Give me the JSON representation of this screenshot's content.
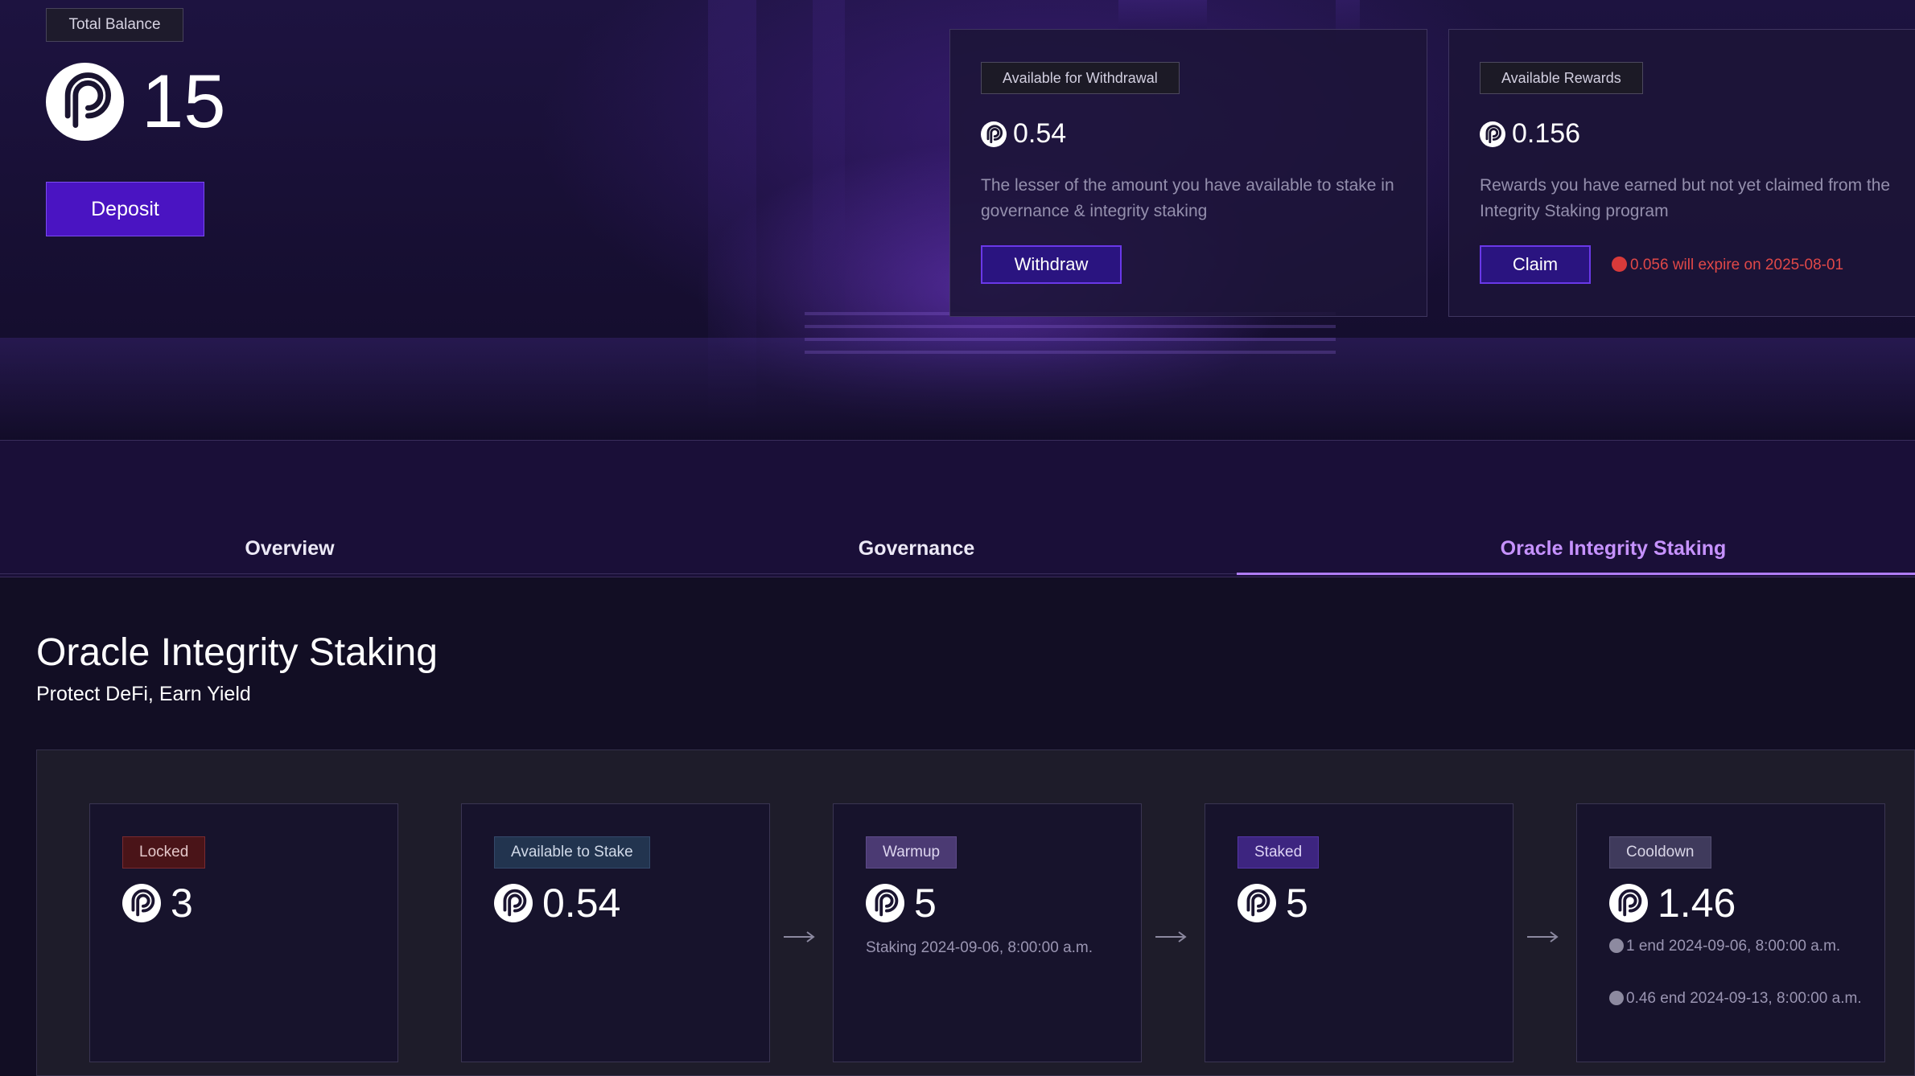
{
  "balance": {
    "label": "Total Balance",
    "value": "15",
    "deposit_label": "Deposit"
  },
  "withdrawal_card": {
    "label": "Available for Withdrawal",
    "value": "0.54",
    "description": "The lesser of the amount you have available to stake in governance & integrity staking",
    "button_label": "Withdraw"
  },
  "rewards_card": {
    "label": "Available Rewards",
    "value": "0.156",
    "description": "Rewards you have earned but not yet claimed from the Integrity Staking program",
    "button_label": "Claim",
    "expiry_warning": "0.056 will expire on 2025-08-01"
  },
  "tabs": [
    {
      "label": "Overview",
      "active": false
    },
    {
      "label": "Governance",
      "active": false
    },
    {
      "label": "Oracle Integrity Staking",
      "active": true
    }
  ],
  "section": {
    "title": "Oracle Integrity Staking",
    "subtitle": "Protect DeFi, Earn Yield"
  },
  "stages": [
    {
      "label": "Locked",
      "value": "3"
    },
    {
      "label": "Available to Stake",
      "value": "0.54"
    },
    {
      "label": "Warmup",
      "value": "5",
      "note": "Staking 2024-09-06, 8:00:00 a.m."
    },
    {
      "label": "Staked",
      "value": "5"
    },
    {
      "label": "Cooldown",
      "value": "1.46",
      "notes": [
        "1 end 2024-09-06, 8:00:00 a.m.",
        "0.46 end 2024-09-13, 8:00:00 a.m."
      ]
    }
  ],
  "colors": {
    "accent_purple": "#4a14c2",
    "active_tab": "#c692ff",
    "warning_red": "#e04848",
    "locked_badge": "#4a1418",
    "available_badge": "#22344f",
    "warmup_badge": "#4b3a73",
    "staked_badge": "#3d2580",
    "cooldown_badge": "#3f3a5c"
  },
  "icons": {
    "coin": "pyth-logo-icon",
    "arrow": "arrow-right-icon",
    "warning": "warning-dot-icon"
  }
}
